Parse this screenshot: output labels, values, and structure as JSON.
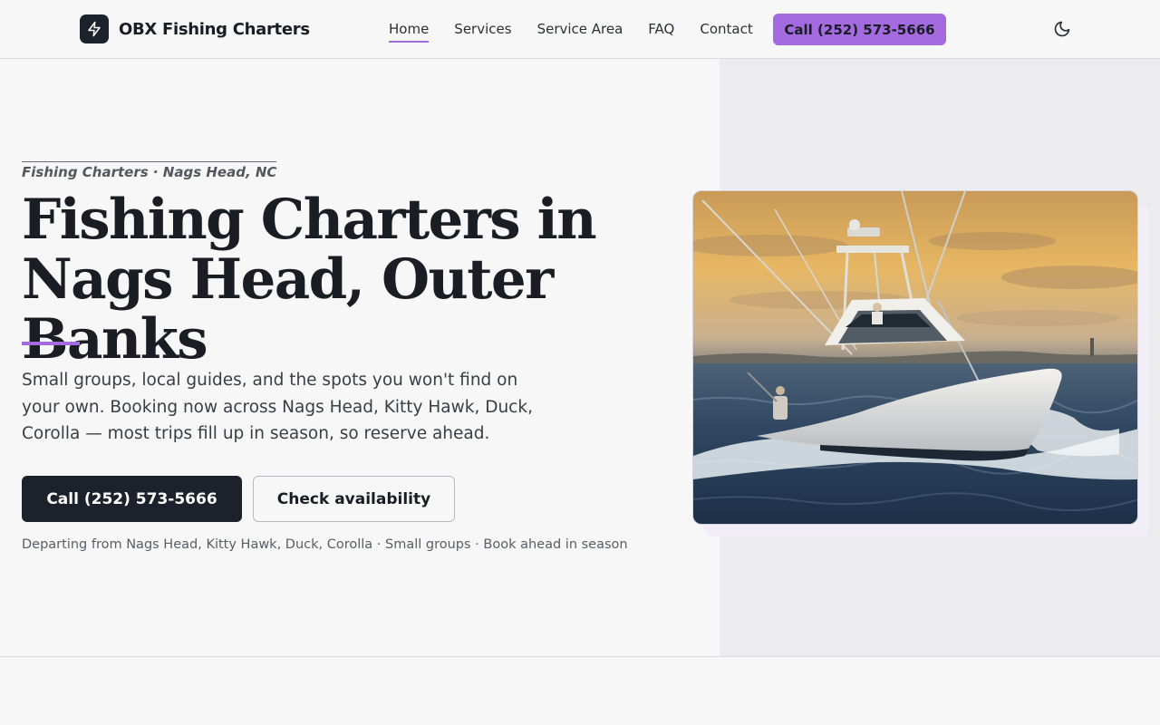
{
  "brand": {
    "name": "OBX Fishing Charters",
    "logo_icon": "bolt-icon"
  },
  "nav": {
    "items": [
      {
        "label": "Home",
        "active": true
      },
      {
        "label": "Services"
      },
      {
        "label": "Service Area"
      },
      {
        "label": "FAQ"
      },
      {
        "label": "Contact"
      }
    ],
    "cta_label": "Call (252) 573-5666",
    "theme_toggle_icon": "moon-icon"
  },
  "hero": {
    "eyebrow": "Fishing Charters · Nags Head, NC",
    "title_line1": "Fishing Charters in",
    "title_line2": "Nags Head, Outer Banks",
    "description": "Small groups, local guides, and the spots you won't find on your own. Booking now across Nags Head, Kitty Hawk, Duck, Corolla — most trips fill up in season, so reserve ahead.",
    "primary_button": "Call (252) 573-5666",
    "secondary_button": "Check availability",
    "meta": "Departing from Nags Head, Kitty Hawk, Duck, Corolla · Small groups · Book ahead in season",
    "image_subject": "sportfishing-boat-at-sunset"
  },
  "colors": {
    "accent": "#a36bdf",
    "dark": "#1c212c",
    "background": "#f7f7f8",
    "panel": "#ececef"
  }
}
